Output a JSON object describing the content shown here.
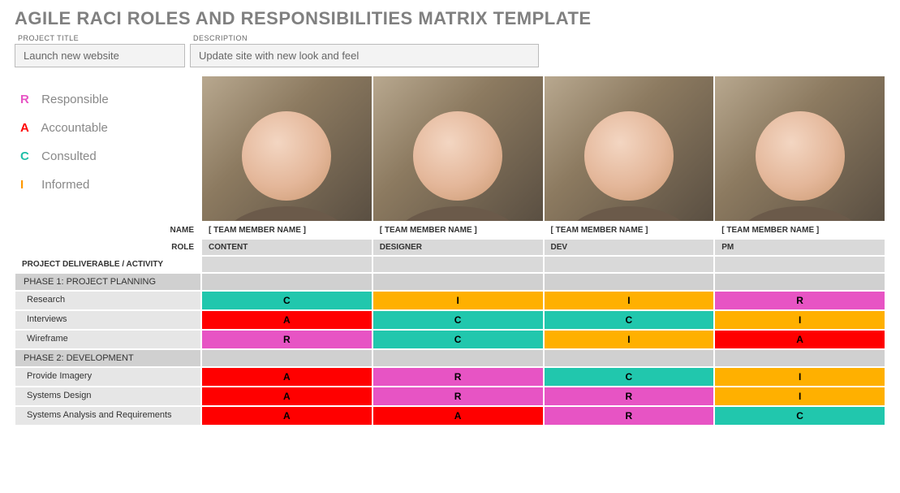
{
  "title": "AGILE RACI ROLES AND RESPONSIBILITIES MATRIX TEMPLATE",
  "meta": {
    "project_title_label": "PROJECT TITLE",
    "project_title_value": "Launch new website",
    "description_label": "DESCRIPTION",
    "description_value": "Update site with new look and feel"
  },
  "legend": [
    {
      "letter": "R",
      "word": "Responsible",
      "cls": "c-R"
    },
    {
      "letter": "A",
      "word": "Accountable",
      "cls": "c-A"
    },
    {
      "letter": "C",
      "word": "Consulted",
      "cls": "c-C"
    },
    {
      "letter": "I",
      "word": "Informed",
      "cls": "c-I"
    }
  ],
  "headers": {
    "name_label": "NAME",
    "role_label": "ROLE",
    "pda_label": "PROJECT DELIVERABLE / ACTIVITY"
  },
  "members": [
    {
      "name": "[ TEAM MEMBER NAME ]",
      "role": "CONTENT"
    },
    {
      "name": "[ TEAM MEMBER NAME ]",
      "role": "DESIGNER"
    },
    {
      "name": "[ TEAM MEMBER NAME ]",
      "role": "DEV"
    },
    {
      "name": "[ TEAM MEMBER NAME ]",
      "role": "PM"
    }
  ],
  "phases": [
    {
      "label": "PHASE 1: PROJECT PLANNING",
      "rows": [
        {
          "activity": "Research",
          "cells": [
            "C",
            "I",
            "I",
            "R"
          ]
        },
        {
          "activity": "Interviews",
          "cells": [
            "A",
            "C",
            "C",
            "I"
          ]
        },
        {
          "activity": "Wireframe",
          "cells": [
            "R",
            "C",
            "I",
            "A"
          ]
        }
      ]
    },
    {
      "label": "PHASE 2: DEVELOPMENT",
      "rows": [
        {
          "activity": "Provide Imagery",
          "cells": [
            "A",
            "R",
            "C",
            "I"
          ]
        },
        {
          "activity": "Systems Design",
          "cells": [
            "A",
            "R",
            "R",
            "I"
          ]
        },
        {
          "activity": "Systems Analysis and Requirements",
          "cells": [
            "A",
            "A",
            "R",
            "C"
          ]
        }
      ]
    }
  ],
  "colors": {
    "R": "bg-R",
    "A": "bg-A",
    "C": "bg-C",
    "I": "bg-I"
  }
}
